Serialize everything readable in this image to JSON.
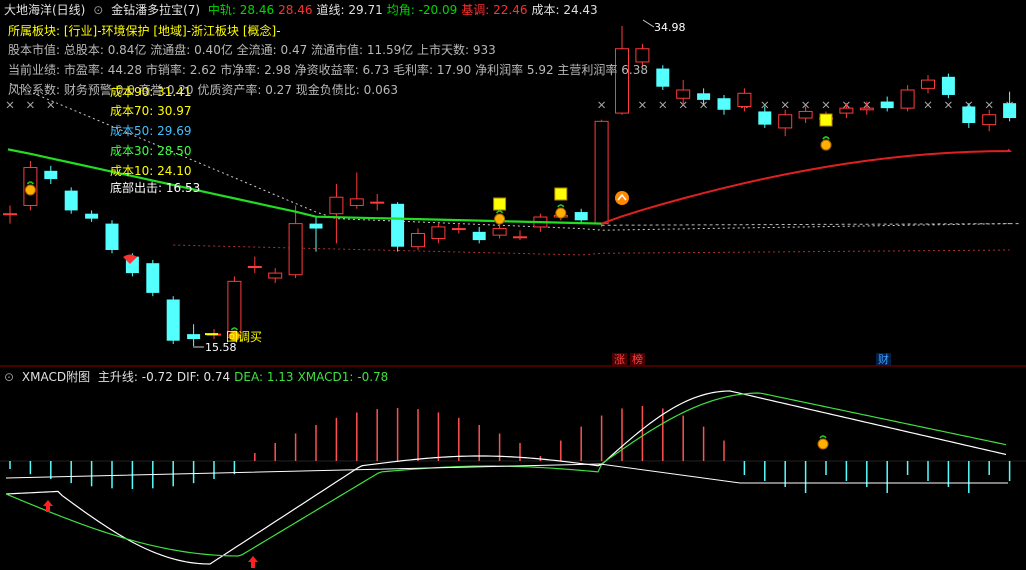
{
  "header": {
    "stock": "大地海洋(日线)",
    "indicator": "金钻潘多拉宝(7)",
    "items": [
      {
        "label": "中轨:",
        "value": "28.46",
        "color": "#00d800"
      },
      {
        "label": "",
        "value": "28.46",
        "color": "#ff3030"
      },
      {
        "label": "道线:",
        "value": "29.71",
        "color": "#e0e0e0"
      },
      {
        "label": "均角:",
        "value": "-20.09",
        "color": "#00d800"
      },
      {
        "label": "基调:",
        "value": "22.46",
        "color": "#ff3030"
      },
      {
        "label": "成本:",
        "value": "24.43",
        "color": "#e0e0e0"
      }
    ]
  },
  "info": {
    "sector_line": "所属板块: [行业]-环境保护 [地域]-浙江板块 [概念]-",
    "capital_line": "股本市值: 总股本: 0.84亿 流通盘: 0.40亿 全流通: 0.47 流通市值: 11.59亿 上市天数: 933",
    "performance_line": "当前业绩: 市盈率: 44.28 市销率: 2.62 市净率: 2.98 净资收益率: 6.73 毛利率: 17.90 净利润率 5.92 主营利润率 6.38",
    "risk_line": "风险系数: 财务预警:0.0 商誉:0.20 优质资产率: 0.27 现金负债比: 0.063"
  },
  "costs": [
    {
      "label": "成本90: 31.41",
      "color": "#ffff00"
    },
    {
      "label": "成本70: 30.97",
      "color": "#ffff00"
    },
    {
      "label": "成本50: 29.69",
      "color": "#40c0ff"
    },
    {
      "label": "成本30: 28.50",
      "color": "#40ff40"
    },
    {
      "label": "成本10: 24.10",
      "color": "#ffff00"
    }
  ],
  "annotations": {
    "bottom_out": "底部出击: 16.53",
    "high": "34.98",
    "low": "15.58",
    "pullback_buy": "回调买",
    "zhang": "涨",
    "bang": "榜",
    "cai": "财"
  },
  "sub": {
    "title": "XMACD附图",
    "items": [
      {
        "label": "主升线:",
        "value": "-0.72",
        "color": "#e0e0e0"
      },
      {
        "label": "DIF:",
        "value": "0.74",
        "color": "#e0e0e0"
      },
      {
        "label": "DEA:",
        "value": "1.13",
        "color": "#40e040"
      },
      {
        "label": "XMACD1:",
        "value": "-0.78",
        "color": "#40e040"
      }
    ]
  },
  "colors": {
    "up": "#ff3b3b",
    "down": "#54ffff",
    "ma": "#22cc22",
    "red_line": "#e02020",
    "bg": "#000000"
  },
  "chart_data": {
    "type": "candlestick",
    "price_range": [
      15.58,
      34.98
    ],
    "candles": [
      {
        "o": 23.6,
        "c": 23.6,
        "h": 24.1,
        "l": 23.0
      },
      {
        "o": 24.1,
        "c": 26.4,
        "h": 26.8,
        "l": 23.8
      },
      {
        "o": 26.2,
        "c": 25.7,
        "h": 26.5,
        "l": 25.4
      },
      {
        "o": 25.0,
        "c": 23.8,
        "h": 25.2,
        "l": 23.6
      },
      {
        "o": 23.6,
        "c": 23.3,
        "h": 23.8,
        "l": 23.1
      },
      {
        "o": 23.0,
        "c": 21.4,
        "h": 23.2,
        "l": 21.2
      },
      {
        "o": 21.0,
        "c": 20.0,
        "h": 21.2,
        "l": 19.8
      },
      {
        "o": 20.6,
        "c": 18.8,
        "h": 20.8,
        "l": 18.6
      },
      {
        "o": 18.4,
        "c": 15.9,
        "h": 18.6,
        "l": 15.7
      },
      {
        "o": 16.3,
        "c": 16.0,
        "h": 16.9,
        "l": 15.58
      },
      {
        "o": 16.3,
        "c": 16.3,
        "h": 16.6,
        "l": 16.0
      },
      {
        "o": 16.1,
        "c": 19.5,
        "h": 19.8,
        "l": 16.0
      },
      {
        "o": 20.4,
        "c": 20.4,
        "h": 21.0,
        "l": 20.0
      },
      {
        "o": 19.7,
        "c": 20.0,
        "h": 20.3,
        "l": 19.4
      },
      {
        "o": 19.9,
        "c": 23.0,
        "h": 24.1,
        "l": 19.7
      },
      {
        "o": 23.0,
        "c": 22.7,
        "h": 23.4,
        "l": 21.3
      },
      {
        "o": 23.6,
        "c": 24.6,
        "h": 25.4,
        "l": 21.8
      },
      {
        "o": 24.1,
        "c": 24.5,
        "h": 26.1,
        "l": 23.9
      },
      {
        "o": 24.3,
        "c": 24.3,
        "h": 24.8,
        "l": 23.8
      },
      {
        "o": 24.2,
        "c": 21.6,
        "h": 24.3,
        "l": 21.3
      },
      {
        "o": 21.6,
        "c": 22.4,
        "h": 22.7,
        "l": 21.4
      },
      {
        "o": 22.1,
        "c": 22.8,
        "h": 23.0,
        "l": 21.8
      },
      {
        "o": 22.7,
        "c": 22.7,
        "h": 23.0,
        "l": 22.4
      },
      {
        "o": 22.5,
        "c": 22.0,
        "h": 22.8,
        "l": 21.8
      },
      {
        "o": 22.3,
        "c": 22.7,
        "h": 23.1,
        "l": 22.1
      },
      {
        "o": 22.2,
        "c": 22.2,
        "h": 22.6,
        "l": 22.0
      },
      {
        "o": 22.8,
        "c": 23.4,
        "h": 23.6,
        "l": 22.5
      },
      {
        "o": 23.4,
        "c": 23.5,
        "h": 23.9,
        "l": 23.2
      },
      {
        "o": 23.7,
        "c": 23.2,
        "h": 23.9,
        "l": 23.0
      },
      {
        "o": 23.0,
        "c": 29.2,
        "h": 29.3,
        "l": 22.8
      },
      {
        "o": 29.7,
        "c": 33.6,
        "h": 34.98,
        "l": 29.6
      },
      {
        "o": 32.8,
        "c": 33.6,
        "h": 33.9,
        "l": 32.5
      },
      {
        "o": 32.4,
        "c": 31.3,
        "h": 32.6,
        "l": 31.1
      },
      {
        "o": 30.6,
        "c": 31.1,
        "h": 31.7,
        "l": 30.2
      },
      {
        "o": 30.9,
        "c": 30.5,
        "h": 31.2,
        "l": 30.2
      },
      {
        "o": 30.6,
        "c": 29.9,
        "h": 30.8,
        "l": 29.6
      },
      {
        "o": 30.1,
        "c": 30.9,
        "h": 31.2,
        "l": 29.8
      },
      {
        "o": 29.8,
        "c": 29.0,
        "h": 30.1,
        "l": 28.8
      },
      {
        "o": 28.8,
        "c": 29.6,
        "h": 29.9,
        "l": 28.3
      },
      {
        "o": 29.4,
        "c": 29.8,
        "h": 30.1,
        "l": 29.1
      },
      {
        "o": 29.4,
        "c": 29.4,
        "h": 29.8,
        "l": 29.1
      },
      {
        "o": 29.7,
        "c": 30.0,
        "h": 30.3,
        "l": 29.4
      },
      {
        "o": 29.9,
        "c": 30.0,
        "h": 30.4,
        "l": 29.6
      },
      {
        "o": 30.4,
        "c": 30.0,
        "h": 30.7,
        "l": 29.8
      },
      {
        "o": 30.0,
        "c": 31.1,
        "h": 31.4,
        "l": 29.8
      },
      {
        "o": 31.2,
        "c": 31.7,
        "h": 32.0,
        "l": 30.9
      },
      {
        "o": 31.9,
        "c": 30.8,
        "h": 32.1,
        "l": 30.6
      },
      {
        "o": 30.1,
        "c": 29.1,
        "h": 30.3,
        "l": 28.8
      },
      {
        "o": 29.0,
        "c": 29.6,
        "h": 29.9,
        "l": 28.6
      },
      {
        "o": 30.3,
        "c": 29.4,
        "h": 31.0,
        "l": 29.2
      }
    ]
  }
}
